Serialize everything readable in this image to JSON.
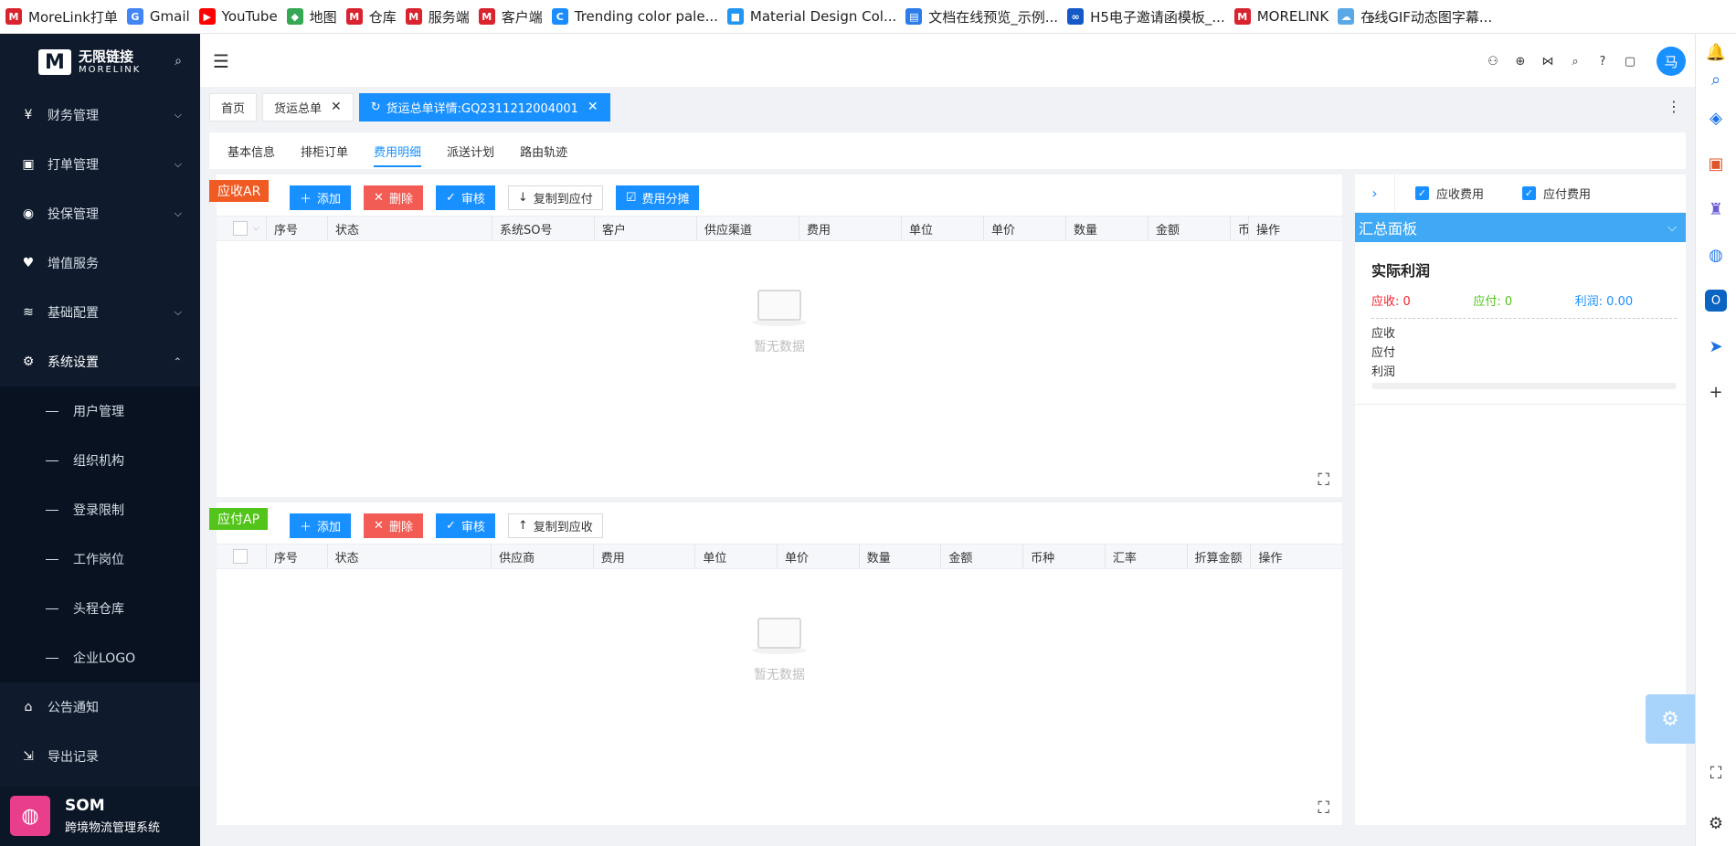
{
  "bookmarks": [
    {
      "label": "MoreLink打单",
      "icon": "M",
      "color": "#d9232e"
    },
    {
      "label": "Gmail",
      "icon": "G",
      "color": "#4285f4"
    },
    {
      "label": "YouTube",
      "icon": "▶",
      "color": "#ff0000"
    },
    {
      "label": "地图",
      "icon": "◆",
      "color": "#34a853"
    },
    {
      "label": "仓库",
      "icon": "M",
      "color": "#d9232e"
    },
    {
      "label": "服务端",
      "icon": "M",
      "color": "#d9232e"
    },
    {
      "label": "客户端",
      "icon": "M",
      "color": "#d9232e"
    },
    {
      "label": "Trending color pale...",
      "icon": "C",
      "color": "#1a8cff"
    },
    {
      "label": "Material Design Col...",
      "icon": "■",
      "color": "#2196f3"
    },
    {
      "label": "文档在线预览_示例...",
      "icon": "▤",
      "color": "#2b7de9"
    },
    {
      "label": "H5电子邀请函模板_...",
      "icon": "∞",
      "color": "#1559c9"
    },
    {
      "label": "MORELINK",
      "icon": "M",
      "color": "#d9232e"
    },
    {
      "label": "在线GIF动态图字幕...",
      "icon": "☁",
      "color": "#5aa9e6"
    }
  ],
  "browser_rail": [
    "bell-icon",
    "search-icon",
    "tag-icon",
    "briefcase-icon",
    "chess-icon",
    "globe-icon",
    "outlook-icon",
    "send-icon",
    "plus-icon",
    "screenshot-icon",
    "gear-icon"
  ],
  "logo": {
    "cn": "无限链接",
    "en": "MORELINK",
    "mark": "M"
  },
  "sidebar": {
    "items": [
      {
        "label": "财务管理",
        "icon": "¥"
      },
      {
        "label": "打单管理",
        "icon": "▣"
      },
      {
        "label": "投保管理",
        "icon": "◉"
      },
      {
        "label": "增值服务",
        "icon": "♥"
      },
      {
        "label": "基础配置",
        "icon": "≋"
      },
      {
        "label": "系统设置",
        "icon": "⚙"
      }
    ],
    "sub_items": [
      "用户管理",
      "组织机构",
      "登录限制",
      "工作岗位",
      "头程仓库",
      "企业LOGO"
    ],
    "bottom_items": [
      {
        "label": "公告通知",
        "icon": "⌂"
      },
      {
        "label": "导出记录",
        "icon": "⇲"
      }
    ],
    "footer": {
      "title": "SOM",
      "subtitle": "跨境物流管理系统"
    }
  },
  "tabs": {
    "home": "首页",
    "waybill": "货运总单",
    "detail": "货运总单详情:GQ2311212004001"
  },
  "subtabs": [
    "基本信息",
    "排柜订单",
    "费用明细",
    "派送计划",
    "路由轨迹"
  ],
  "ar": {
    "badge": "应收AR",
    "buttons": {
      "add": "添加",
      "delete": "删除",
      "audit": "审核",
      "copy": "复制到应付",
      "split": "费用分摊"
    },
    "columns": [
      "序号",
      "状态",
      "系统SO号",
      "客户",
      "供应渠道",
      "费用",
      "单位",
      "单价",
      "数量",
      "金额",
      "币",
      "操作"
    ],
    "empty": "暂无数据"
  },
  "ap": {
    "badge": "应付AP",
    "buttons": {
      "add": "添加",
      "delete": "删除",
      "audit": "审核",
      "copy": "复制到应收"
    },
    "columns": [
      "序号",
      "状态",
      "供应商",
      "费用",
      "单位",
      "单价",
      "数量",
      "金额",
      "币种",
      "汇率",
      "折算金额",
      "操作"
    ],
    "empty": "暂无数据"
  },
  "summary": {
    "check_receivable": "应收费用",
    "check_payable": "应付费用",
    "header": "汇总面板",
    "title": "实际利润",
    "receivable": "应收: 0",
    "payable": "应付: 0",
    "profit": "利润: 0.00",
    "rows": [
      "应收",
      "应付",
      "利润"
    ]
  },
  "user": {
    "avatar": "马"
  }
}
